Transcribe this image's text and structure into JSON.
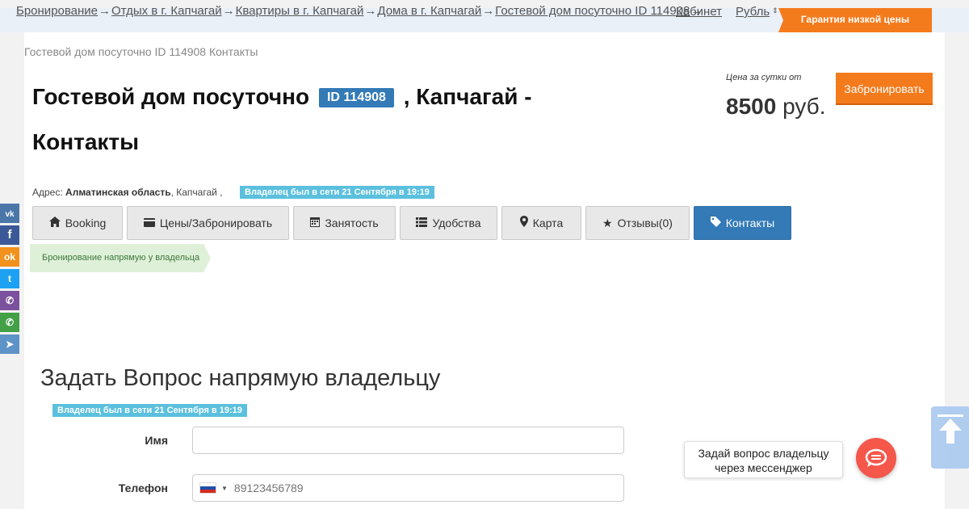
{
  "breadcrumbs": [
    "Бронирование",
    "Отдых в г. Капчагай",
    "Квартиры в г. Капчагай",
    "Дома в г. Капчагай",
    "Гостевой дом посуточно ID 114908"
  ],
  "breadcrumb_separator": "→",
  "topnav": {
    "cabinet": "Кабинет",
    "currency": "Рубль",
    "guarantee": "Гарантия низкой цены"
  },
  "page_crumb": "Гостевой дом посуточно ID 114908 Контакты",
  "title": {
    "part1": "Гостевой дом посуточно",
    "id_badge": "ID 114908",
    "part2": ", Капчагай -",
    "part3": "Контакты"
  },
  "price": {
    "label": "Цена за сутки от",
    "amount": "8500",
    "currency": "руб.",
    "book_button": "Забронировать"
  },
  "address": {
    "label": "Адрес:",
    "region": "Алматинская область",
    "city": ", Капчагай ,"
  },
  "owner_status": "Владелец был в сети 21 Сентября в 19:19",
  "tabs": [
    {
      "label": "Booking",
      "icon": "home-icon"
    },
    {
      "label": "Цены/Забронировать",
      "icon": "card-icon"
    },
    {
      "label": "Занятость",
      "icon": "calendar-icon"
    },
    {
      "label": "Удобства",
      "icon": "list-icon"
    },
    {
      "label": "Карта",
      "icon": "map-marker-icon"
    },
    {
      "label": "Отзывы(0)",
      "icon": "star-icon"
    },
    {
      "label": "Контакты",
      "icon": "tag-icon",
      "active": true
    }
  ],
  "direct_booking": "Бронирование напрямую у владельца",
  "social": [
    "vk",
    "facebook",
    "odnoklassniki",
    "twitter",
    "viber",
    "whatsapp",
    "telegram"
  ],
  "form": {
    "heading": "Задать Вопрос напрямую владельцу",
    "name_label": "Имя",
    "phone_label": "Телефон",
    "phone_placeholder": "89123456789"
  },
  "chat": {
    "line1": "Задай вопрос владельцу",
    "line2": "через мессенджер"
  },
  "colors": {
    "primary": "#337ab7",
    "accent": "#f47b1c",
    "info": "#5bc0de",
    "success_bg": "#dff0d8"
  }
}
